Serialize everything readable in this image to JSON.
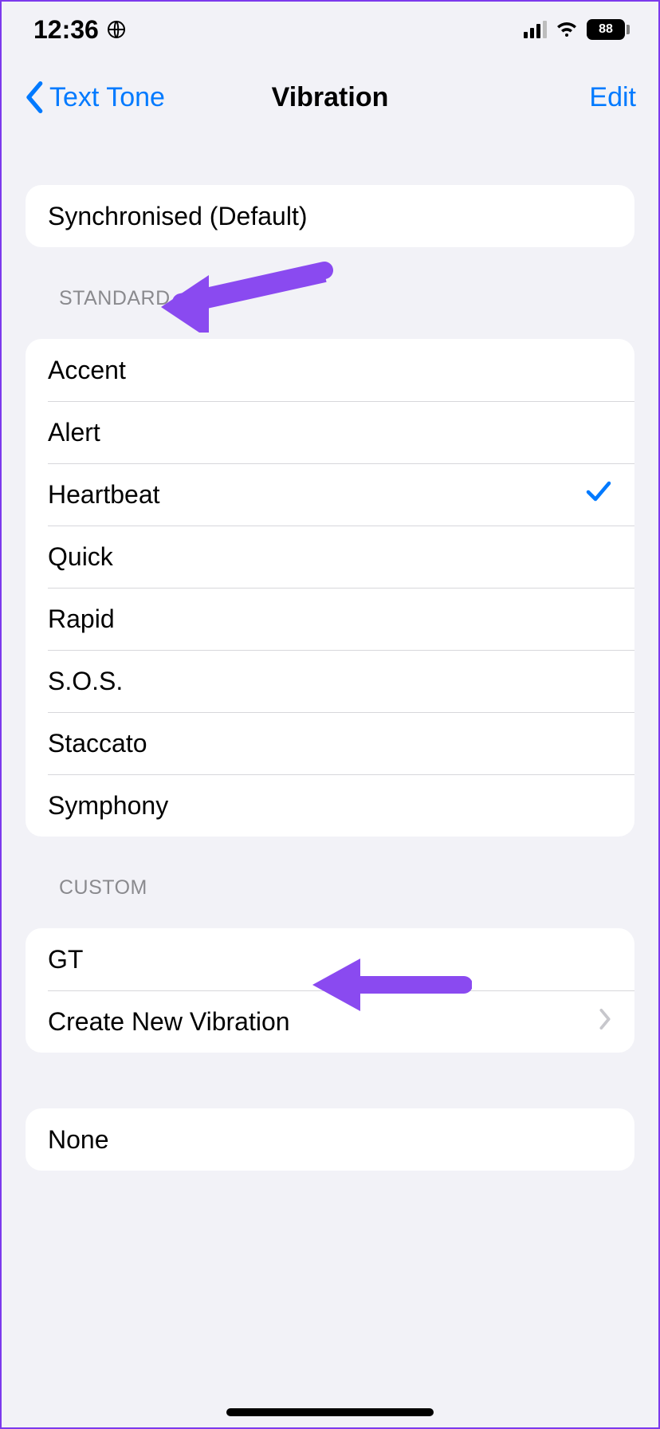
{
  "status": {
    "time": "12:36",
    "battery": "88"
  },
  "nav": {
    "back_label": "Text Tone",
    "title": "Vibration",
    "edit_label": "Edit"
  },
  "default_group": {
    "item": "Synchronised (Default)"
  },
  "standard": {
    "header": "STANDARD",
    "items": [
      "Accent",
      "Alert",
      "Heartbeat",
      "Quick",
      "Rapid",
      "S.O.S.",
      "Staccato",
      "Symphony"
    ],
    "selected_index": 2
  },
  "custom": {
    "header": "CUSTOM",
    "items": [
      "GT"
    ],
    "create_label": "Create New Vibration"
  },
  "none_group": {
    "item": "None"
  },
  "annotation": {
    "arrow_color": "#8a4af0"
  }
}
